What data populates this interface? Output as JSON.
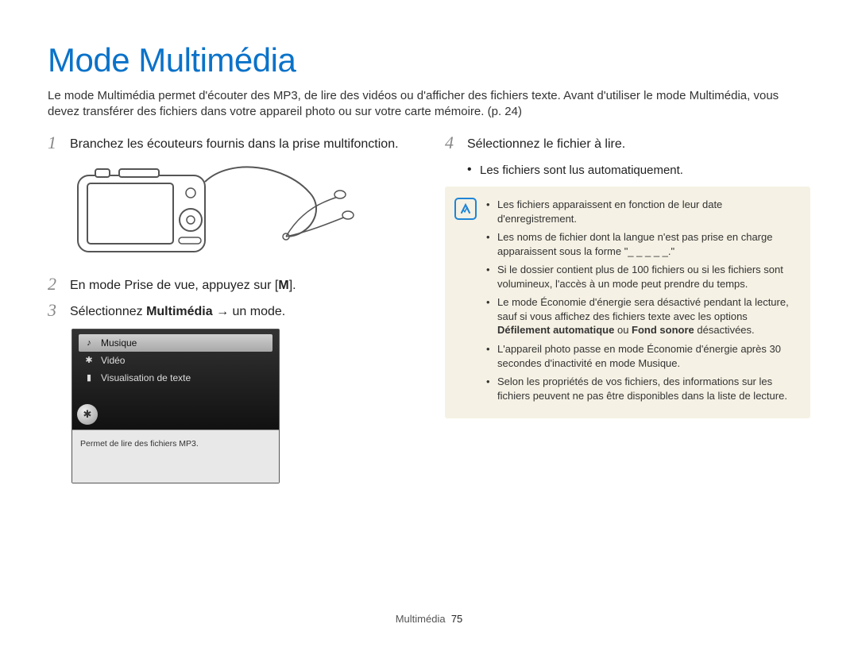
{
  "page": {
    "title": "Mode Multimédia",
    "intro": "Le mode Multimédia permet d'écouter des MP3, de lire des vidéos ou d'afficher des fichiers texte. Avant d'utiliser le mode Multimédia, vous devez transférer des fichiers dans votre appareil photo ou sur votre carte mémoire. (p. 24)"
  },
  "steps": {
    "s1": {
      "num": "1",
      "text": "Branchez les écouteurs fournis dans la prise multifonction."
    },
    "s2": {
      "num": "2",
      "text_before": "En mode Prise de vue, appuyez sur [",
      "key": "M",
      "text_after": "]."
    },
    "s3": {
      "num": "3",
      "text_before": "Sélectionnez ",
      "bold": "Multimédia",
      "text_after": " → un mode."
    },
    "s4": {
      "num": "4",
      "text": "Sélectionnez le fichier à lire."
    },
    "s4_bullet": "Les fichiers sont lus automatiquement."
  },
  "screenshot": {
    "menu": {
      "musique": "Musique",
      "video": "Vidéo",
      "texte": "Visualisation de texte"
    },
    "caption": "Permet de lire des fichiers MP3."
  },
  "notes": {
    "n1": "Les fichiers apparaissent en fonction de leur date d'enregistrement.",
    "n2": "Les noms de fichier dont la langue n'est pas prise en charge apparaissent sous la forme \"_ _ _ _ _.\"",
    "n3": "Si le dossier contient plus de 100 fichiers ou si les fichiers sont volumineux, l'accès à un mode peut prendre du temps.",
    "n4_a": "Le mode Économie d'énergie sera désactivé pendant la lecture, sauf si vous affichez des fichiers texte avec les options ",
    "n4_b1": "Défilement automatique",
    "n4_mid": " ou ",
    "n4_b2": "Fond sonore",
    "n4_c": " désactivées.",
    "n5": "L'appareil photo passe en mode Économie d'énergie après 30 secondes d'inactivité en mode Musique.",
    "n6": "Selon les propriétés de vos fichiers, des informations sur les fichiers peuvent ne pas être disponibles dans la liste de lecture."
  },
  "footer": {
    "section": "Multimédia",
    "page_number": "75"
  }
}
